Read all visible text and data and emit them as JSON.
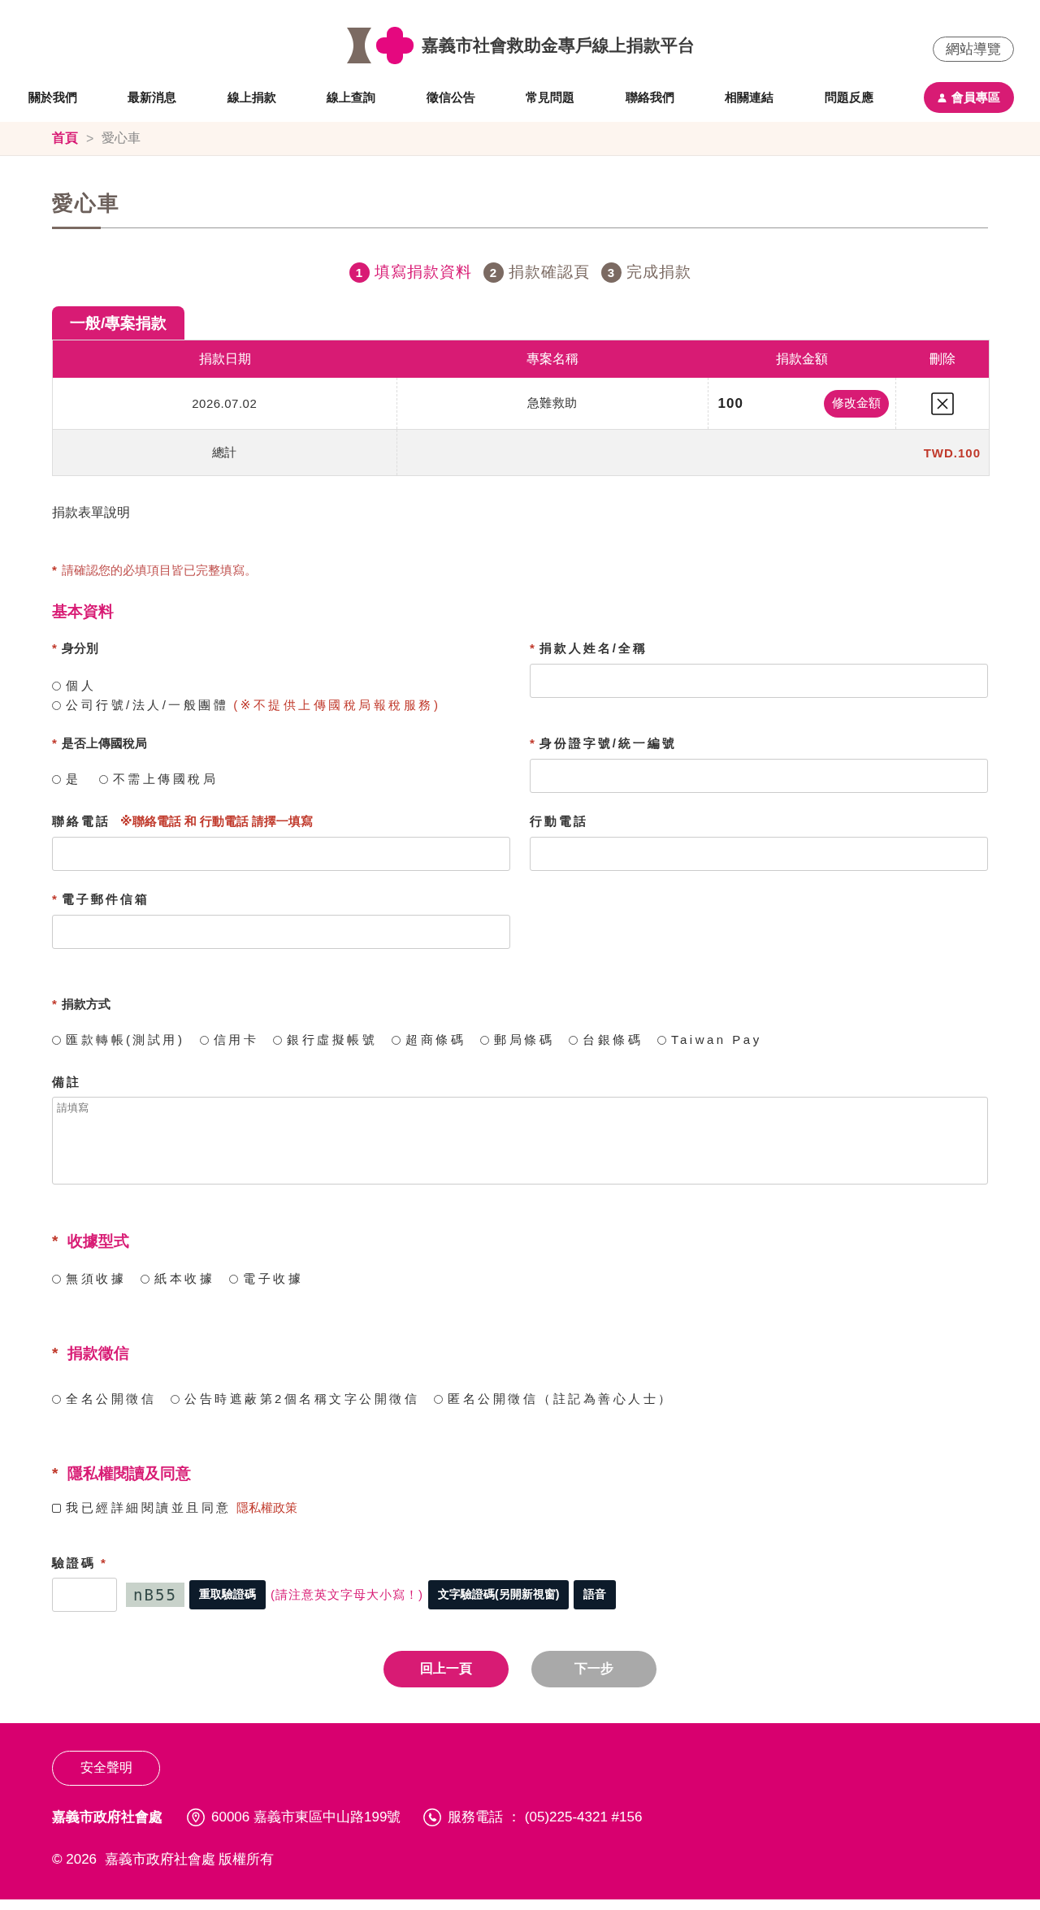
{
  "header": {
    "site_title": "嘉義市社會救助金專戶線上捐款平台",
    "sitemap_button": "網站導覽",
    "nav": [
      "關於我們",
      "最新消息",
      "線上捐款",
      "線上查詢",
      "徵信公告",
      "常見問題",
      "聯絡我們",
      "相關連結",
      "問題反應"
    ],
    "member_button": "會員專區"
  },
  "breadcrumb": {
    "items": [
      {
        "label": "首頁",
        "current": false
      },
      {
        "label": "愛心車",
        "current": true
      }
    ],
    "separator": ">"
  },
  "page_title": "愛心車",
  "steps": [
    {
      "number": "1",
      "label": "填寫捐款資料",
      "selected": true
    },
    {
      "number": "2",
      "label": "捐款確認頁",
      "selected": false
    },
    {
      "number": "3",
      "label": "完成捐款",
      "selected": false
    }
  ],
  "cart": {
    "tab": "一般/專案捐款",
    "columns": [
      "捐款日期",
      "專案名稱",
      "捐款金額",
      "刪除"
    ],
    "rows": [
      {
        "date": "2026.07.02",
        "project": "急難救助",
        "amount": "100",
        "edit_button": "修改金額"
      }
    ],
    "total": {
      "label": "總計",
      "value": "TWD.100"
    }
  },
  "form_description": "捐款表單說明",
  "required_mark": "*",
  "required_notice": "請確認您的必填項目皆已完整填寫。",
  "basic_info": {
    "title": "基本資料",
    "fields": [
      {
        "kind": "radiocolumn",
        "label": "身分別",
        "required": true,
        "options": [
          {
            "label": "個人",
            "selected": false
          },
          {
            "label": "公司行號/法人/一般團體",
            "note": "(※不提供上傳國稅局報稅服務)",
            "selected": false
          }
        ]
      },
      {
        "kind": "text",
        "label": "捐款人姓名/全稱",
        "required": true
      },
      {
        "kind": "radiorow",
        "label": "是否上傳國稅局",
        "required": true,
        "options": [
          {
            "label": "是",
            "selected": false
          },
          {
            "label": "不需上傳國稅局",
            "selected": false
          }
        ]
      },
      {
        "kind": "text",
        "label": "身份證字號/統一編號",
        "required": true
      },
      {
        "kind": "text",
        "label": "聯絡電話",
        "required": false,
        "note": "※聯絡電話 和 行動電話 請擇一填寫"
      },
      {
        "kind": "text",
        "label": "行動電話",
        "required": false
      },
      {
        "kind": "text",
        "label": "電子郵件信箱",
        "required": true
      }
    ]
  },
  "payment": {
    "label": "捐款方式",
    "required": true,
    "options": [
      {
        "label": "匯款轉帳(測試用)",
        "selected": false
      },
      {
        "label": "信用卡",
        "selected": false
      },
      {
        "label": "銀行虛擬帳號",
        "selected": false
      },
      {
        "label": "超商條碼",
        "selected": false
      },
      {
        "label": "郵局條碼",
        "selected": false
      },
      {
        "label": "台銀條碼",
        "selected": false
      },
      {
        "label": "Taiwan Pay",
        "selected": false
      }
    ]
  },
  "remarks": {
    "label": "備註",
    "placeholder": "請填寫"
  },
  "receipt": {
    "title": "收據型式",
    "required": true,
    "options": [
      {
        "label": "無須收據",
        "selected": false
      },
      {
        "label": "紙本收據",
        "selected": false
      },
      {
        "label": "電子收據",
        "selected": false
      }
    ]
  },
  "acknowledgement": {
    "title": "捐款徵信",
    "required": true,
    "options": [
      {
        "label": "全名公開徵信",
        "selected": false
      },
      {
        "label": "公告時遮蔽第2個名稱文字公開徵信",
        "selected": false
      },
      {
        "label": "匿名公開徵信（註記為善心人士）",
        "selected": false
      }
    ]
  },
  "privacy": {
    "title": "隱私權閱讀及同意",
    "required": true,
    "checkbox": {
      "label": "我已經詳細閱讀並且同意",
      "checked": false
    },
    "link": "隱私權政策"
  },
  "captcha": {
    "label": "驗證碼",
    "required": true,
    "image_text": "nB55",
    "refresh_button": "重取驗證碼",
    "case_note": "(請注意英文字母大小寫！)",
    "text_captcha_button": "文字驗證碼(另開新視窗)",
    "audio_button": "語音"
  },
  "actions": [
    {
      "label": "回上一頁",
      "disabled": false
    },
    {
      "label": "下一步",
      "disabled": true
    }
  ],
  "footer": {
    "security_button": "安全聲明",
    "org": "嘉義市政府社會處",
    "address": "60006 嘉義市東區中山路199號",
    "phone": "服務電話 ： (05)225-4321 #156",
    "copyright": "© 2026  嘉義市政府社會處 版權所有"
  }
}
